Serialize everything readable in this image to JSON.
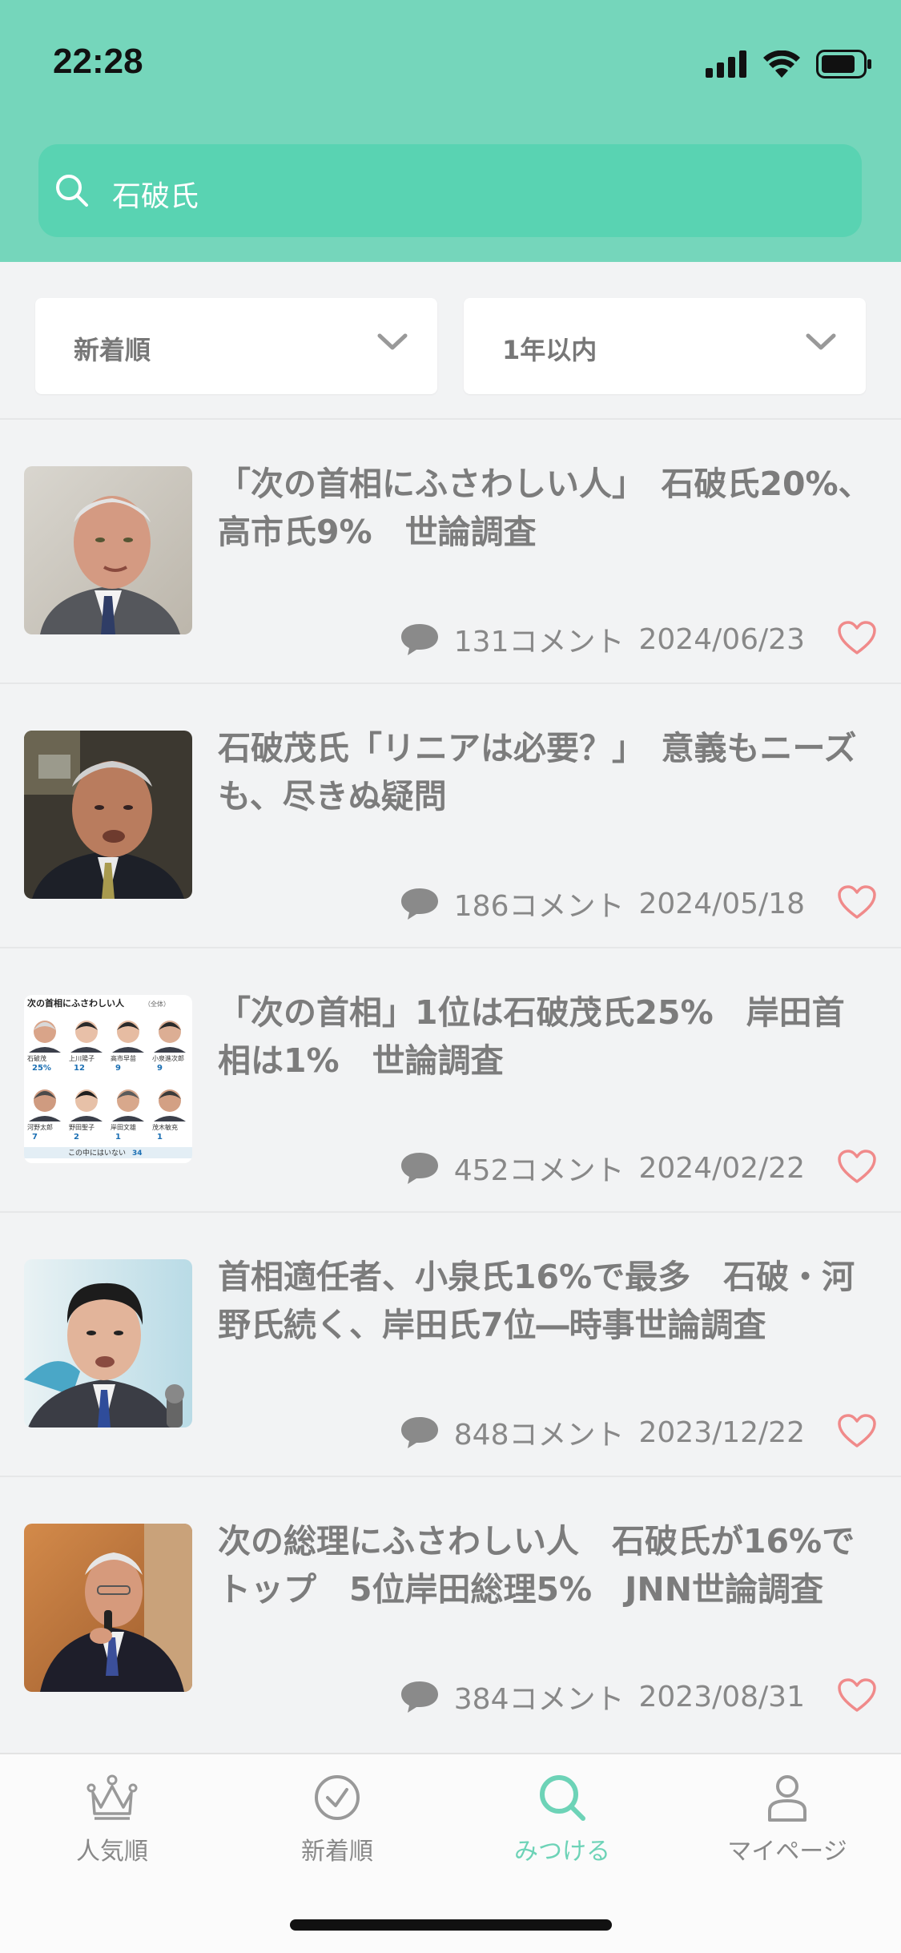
{
  "status": {
    "time": "22:28"
  },
  "search": {
    "query": "石破氏"
  },
  "filters": {
    "sort": "新着順",
    "period": "1年以内"
  },
  "articles": [
    {
      "title": "「次の首相にふさわしい人」　石破氏20%、高市氏9%　世論調査",
      "comments": "131コメント",
      "date": "2024/06/23"
    },
    {
      "title": "石破茂氏「リニアは必要？」　意義もニーズも、尽きぬ疑問",
      "comments": "186コメント",
      "date": "2024/05/18"
    },
    {
      "title": "「次の首相」1位は石破茂氏25%　岸田首相は1%　世論調査",
      "comments": "452コメント",
      "date": "2024/02/22"
    },
    {
      "title": "首相適任者、小泉氏16%で最多　石破・河野氏続く、岸田氏7位―時事世論調査",
      "comments": "848コメント",
      "date": "2023/12/22"
    },
    {
      "title": "次の総理にふさわしい人　石破氏が16%でトップ　5位岸田総理5%　JNN世論調査",
      "comments": "384コメント",
      "date": "2023/08/31"
    }
  ],
  "thumb3": {
    "heading": "次の首相にふさわしい人",
    "note": "（全体）",
    "people": [
      {
        "name": "石破茂",
        "value": "25%"
      },
      {
        "name": "上川陽子",
        "value": "12"
      },
      {
        "name": "高市早苗",
        "value": "9"
      },
      {
        "name": "小泉進次郎",
        "value": "9"
      },
      {
        "name": "河野太郎",
        "value": "7"
      },
      {
        "name": "野田聖子",
        "value": "2"
      },
      {
        "name": "岸田文雄",
        "value": "1"
      },
      {
        "name": "茂木敏充",
        "value": "1"
      }
    ],
    "footer": "この中にはいない",
    "footer_value": "34"
  },
  "tabs": [
    {
      "label": "人気順",
      "icon": "crown-icon"
    },
    {
      "label": "新着順",
      "icon": "clock-icon"
    },
    {
      "label": "みつける",
      "icon": "search-icon"
    },
    {
      "label": "マイページ",
      "icon": "person-icon"
    }
  ],
  "colors": {
    "accent": "#6dd3b7",
    "header": "#75d6bb",
    "heart": "#f08a8a"
  }
}
